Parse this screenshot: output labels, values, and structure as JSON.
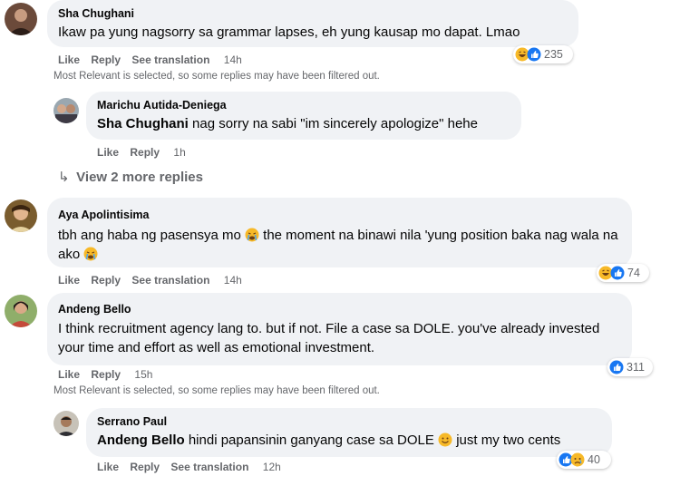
{
  "actions": {
    "like": "Like",
    "reply": "Reply",
    "see_translation": "See translation"
  },
  "filter_note": "Most Relevant is selected, so some replies may have been filtered out.",
  "comments": [
    {
      "author": "Sha Chughani",
      "text": "Ikaw pa yung nagsorry sa grammar lapses, eh yung kausap mo dapat. Lmao",
      "time": "14h",
      "reaction_count": "235",
      "reactions": [
        "haha",
        "like"
      ]
    },
    {
      "author": "Marichu Autida-Deniega",
      "mention": "Sha Chughani",
      "text": " nag sorry na sabi \"im sincerely apologize\" hehe",
      "time": "1h"
    },
    {
      "author": "Aya Apolintisima",
      "text_part1": "tbh ang haba ng pasensya mo ",
      "text_part2": " the moment na binawi nila 'yung position baka nag wala na ako ",
      "time": "14h",
      "reaction_count": "74",
      "reactions": [
        "haha",
        "like"
      ]
    },
    {
      "author": "Andeng Bello",
      "text": "I think recruitment agency lang to. but if not. File a case sa DOLE. you've already invested your time and effort as well as emotional investment.",
      "time": "15h",
      "reaction_count": "311",
      "reactions": [
        "like"
      ]
    },
    {
      "author": "Serrano Paul",
      "mention": "Andeng Bello",
      "text_part1": " hindi papansinin ganyang case sa DOLE ",
      "text_part2": " just my two cents",
      "time": "12h",
      "reaction_count": "40",
      "reactions": [
        "like",
        "sad"
      ]
    }
  ],
  "view_more_replies": "View 2 more replies",
  "colors": {
    "bubble": "#f0f2f5",
    "secondary_text": "#65676b",
    "like_blue": "#1877f2",
    "emoji_yellow": "#f7b928"
  }
}
